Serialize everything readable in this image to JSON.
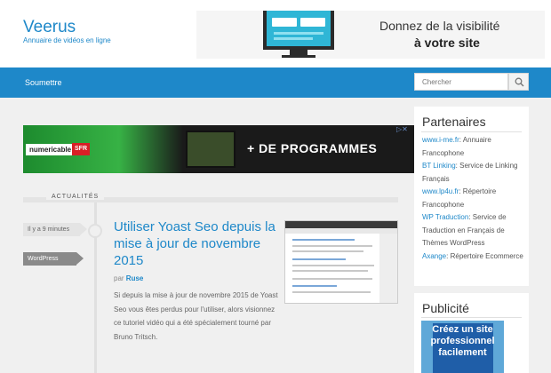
{
  "site": {
    "title": "Veerus",
    "tagline": "Annuaire de vidéos en ligne"
  },
  "header_banner": {
    "line1": "Donnez de la visibilité",
    "line2": "à votre site"
  },
  "nav": {
    "items": [
      "Soumettre"
    ]
  },
  "search": {
    "placeholder": "Chercher"
  },
  "ad": {
    "brand": "numericable",
    "operator": "SFR",
    "title": "+ DE PROGRAMMES",
    "close": "▷✕"
  },
  "section": {
    "label": "ACTUALITÉS"
  },
  "post": {
    "time": "Il y a 9 minutes",
    "category": "WordPress",
    "title": "Utiliser Yoast Seo depuis la mise à jour de novembre 2015",
    "by": "par",
    "author": "Ruse",
    "excerpt": "Si depuis la mise à jour de novembre 2015 de Yoast Seo vous êtes perdus pour l'utiliser, alors visionnez ce tutoriel vidéo qui a été spécialement tourné par Bruno Tritsch."
  },
  "sidebar": {
    "partners_title": "Partenaires",
    "partners": [
      {
        "link": "www.i-me.fr",
        "desc": ": Annuaire Francophone"
      },
      {
        "link": "BT Linking",
        "desc": ": Service de Linking Français"
      },
      {
        "link": "www.lp4u.fr",
        "desc": ": Répertoire Francophone"
      },
      {
        "link": "WP Traduction",
        "desc": ": Service de Traduction en Français de Thèmes WordPress"
      },
      {
        "link": "Axange",
        "desc": ": Répertoire Ecommerce"
      }
    ],
    "pub_title": "Publicité",
    "pub_lines": [
      "Créez un site",
      "professionnel",
      "facilement"
    ]
  },
  "colors": {
    "accent": "#1e88c9",
    "background": "#f0f0f0"
  }
}
